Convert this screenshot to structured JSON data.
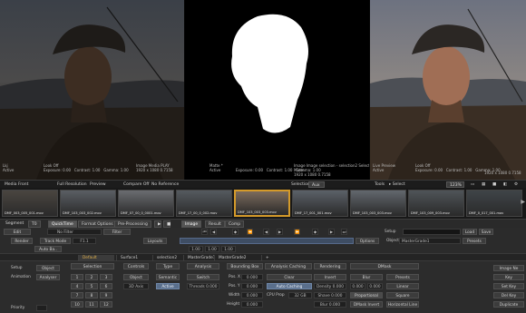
{
  "viewers": {
    "left": {
      "top_left": "",
      "bottom_left": "Lkj\nActive",
      "bottom_mid": "Look Off\nExposure: 0.00   Contrast: 1.00   Gamma: 1.00",
      "bottom_right": "Image Media PLAY\n1920 x 1080 0.7158"
    },
    "middle": {
      "bottom_left": "Matte *\nActive",
      "bottom_mid": "Exposure: 0.00   Contrast: 1.00   Gamma: 1.00",
      "bottom_right": "Image Image selection - selection2 Selection Matte\nMatte\n1920 x 1080 0.7158"
    },
    "right": {
      "bottom_left": "Live Preview\nActive",
      "bottom_mid": "Look Off\nExposure: 0.00   Contrast: 1.00   Gamma: 1.00",
      "bottom_right": "1920 x 1080 0.7158"
    }
  },
  "menubar": {
    "media_view": "Media Front",
    "full_res": "Full Resolution",
    "preview": "Preview",
    "compare": "Compare Off",
    "no_ref": "No Reference",
    "selection_label": "Selection",
    "selection_value": "Aux",
    "tools": "Tools",
    "select": "Select",
    "zoom": "123%"
  },
  "filmstrip": {
    "items": [
      {
        "label": "DMF_003_005_001.mov",
        "selected": false
      },
      {
        "label": "DMF_103_003_002.mov",
        "selected": false
      },
      {
        "label": "DMF_07_00_0_0001.mov",
        "selected": false
      },
      {
        "label": "DMF_17_00_0_002.mov",
        "selected": false
      },
      {
        "label": "DMF_103_003_003.mov",
        "selected": true
      },
      {
        "label": "DMF_17_001_001.mov",
        "selected": false
      },
      {
        "label": "DMF_103_003_003.mov",
        "selected": false
      },
      {
        "label": "DMF_103_009_003.mov",
        "selected": false
      },
      {
        "label": "DMF_0_017_001.mov",
        "selected": false
      }
    ]
  },
  "tabrow": {
    "segment": "Segment",
    "segment_val": "T0",
    "quicktime": "QuickTime",
    "format": "Format Options",
    "preprocess": "Pre-Processing",
    "image": "Image",
    "result": "Result",
    "comp": "Comp"
  },
  "row1": {
    "edit": "Edit",
    "filter_ph": "No Filter",
    "filter": "Filter",
    "setup": "Setup",
    "load": "Load",
    "save": "Save"
  },
  "row2": {
    "render": "Render",
    "track_mode": "Track Mode",
    "track_val": "F1.1",
    "layouts": "Layouts",
    "options": "Options",
    "object": "Object",
    "object_val": "MasterGrade1",
    "presets": "Presets"
  },
  "row3": {
    "auto": "Auto Ba..",
    "r1": "1.00",
    "r2": "1.00",
    "r3": "1.00"
  },
  "tabs2": [
    "Default",
    "Surface1",
    "selection2",
    "MasterGrade1",
    "MasterGrade2",
    "+"
  ],
  "panel": {
    "headers": [
      "Selection",
      "Controls",
      "Type",
      "Analysis",
      "Bounding Box",
      "Analysis Caching",
      "Rendering",
      "DMask"
    ],
    "setup": "Setup",
    "animation": "Animation",
    "priority": "Priority",
    "object": "Object",
    "analyser": "Analyser",
    "sel_keys": [
      "1",
      "2",
      "3",
      "4",
      "5",
      "6",
      "7",
      "8",
      "9",
      "10",
      "11",
      "12"
    ],
    "controls_object": "Object",
    "controls_3d": "3D Axis",
    "type_semantic": "Semantic",
    "type_active": "Active",
    "analysis_switch": "Switch",
    "analysis_threads": "Threads 0.000",
    "bbox_labels": [
      "Pos. X",
      "Pos. Y",
      "Width",
      "Height"
    ],
    "bbox_values": [
      "0.000",
      "0.000",
      "0.000",
      "0.000"
    ],
    "cache_clear": "Clear",
    "cache_auto": "Auto Caching",
    "cache_cpu": "CPU Prop",
    "cache_cpu_val": "32 GB",
    "render_labels": [
      "Invert",
      "Density 0.000",
      "Shave 0.000",
      "Blur 0.000"
    ],
    "render_blur": "Blur",
    "render_prop": "Proportional",
    "render_dmask": "DMask Invert",
    "dmask": [
      "Presets",
      "Linear",
      "Square",
      "Horizontal Line"
    ],
    "right": [
      "Image Ne",
      "Key",
      "Set Key",
      "Del Key",
      "Duplicate"
    ]
  }
}
